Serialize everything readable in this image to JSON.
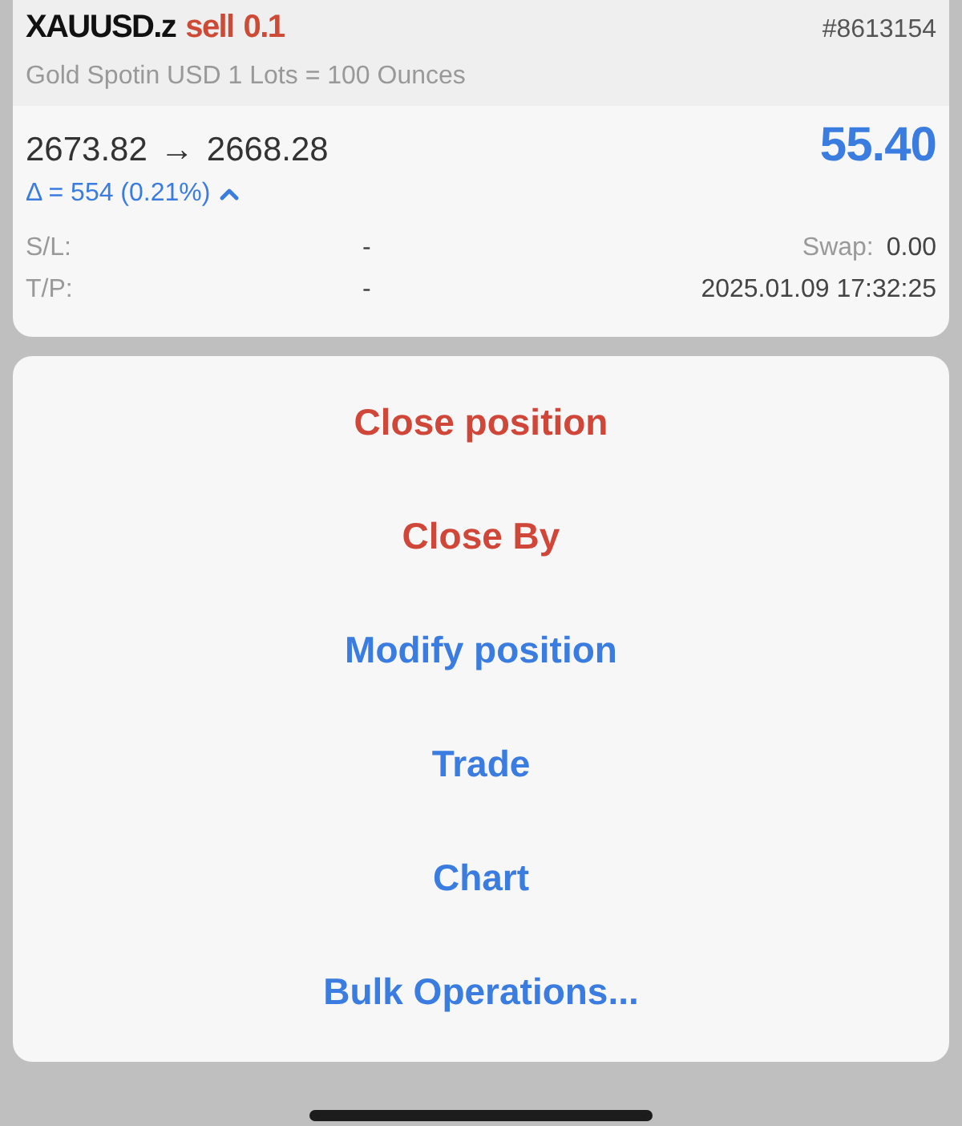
{
  "position": {
    "symbol": "XAUUSD.z",
    "side": "sell",
    "volume": "0.1",
    "ticket": "#8613154",
    "description": "Gold Spotin USD 1 Lots = 100 Ounces",
    "open_price": "2673.82",
    "arrow": "→",
    "current_price": "2668.28",
    "profit": "55.40",
    "delta": "Δ = 554 (0.21%)",
    "delta_up": true,
    "sl_label": "S/L:",
    "sl_value": "-",
    "swap_label": "Swap:",
    "swap_value": "0.00",
    "tp_label": "T/P:",
    "tp_value": "-",
    "time": "2025.01.09 17:32:25"
  },
  "actions": [
    {
      "label": "Close position",
      "kind": "destructive"
    },
    {
      "label": "Close By",
      "kind": "destructive"
    },
    {
      "label": "Modify position",
      "kind": "default"
    },
    {
      "label": "Trade",
      "kind": "default"
    },
    {
      "label": "Chart",
      "kind": "default"
    },
    {
      "label": "Bulk Operations...",
      "kind": "default"
    }
  ]
}
